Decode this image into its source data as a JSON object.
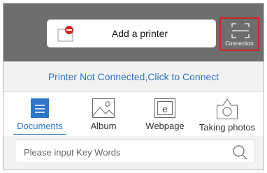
{
  "header": {
    "add_printer_label": "Add a printer",
    "connection_label": "Connection"
  },
  "status": {
    "text": "Printer Not Connected,Click to Connect"
  },
  "tabs": [
    {
      "label": "Documents",
      "icon": "document-icon",
      "active": true
    },
    {
      "label": "Album",
      "icon": "image-icon",
      "active": false
    },
    {
      "label": "Webpage",
      "icon": "webpage-icon",
      "active": false
    },
    {
      "label": "Taking photos",
      "icon": "camera-icon",
      "active": false
    }
  ],
  "search": {
    "placeholder": "Please input Key Words",
    "value": ""
  },
  "colors": {
    "accent": "#2f75c8",
    "header_bg": "#6e6e6e",
    "highlight": "#d0231f"
  }
}
